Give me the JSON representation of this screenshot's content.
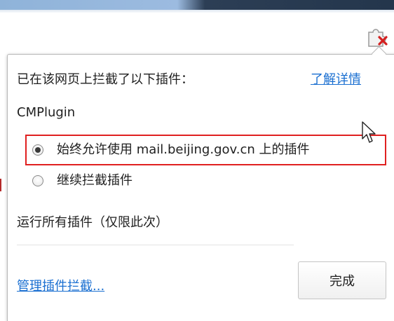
{
  "bubble": {
    "header_text": "已在该网页上拦截了以下插件：",
    "learn_more_link": "了解详情",
    "plugin_name": "CMPlugin",
    "options": [
      {
        "label": "始终允许使用 mail.beijing.gov.cn 上的插件",
        "checked": true
      },
      {
        "label": "继续拦截插件",
        "checked": false
      }
    ],
    "run_all_text": "运行所有插件（仅限此次）",
    "manage_link": "管理插件拦截...",
    "done_button": "完成"
  },
  "toolbar": {
    "plugin_blocked_icon": "puzzle-piece-with-red-x-icon"
  },
  "colors": {
    "link": "#1a6fd1",
    "highlight_border": "#e02020",
    "blocked_x": "#d42020"
  }
}
